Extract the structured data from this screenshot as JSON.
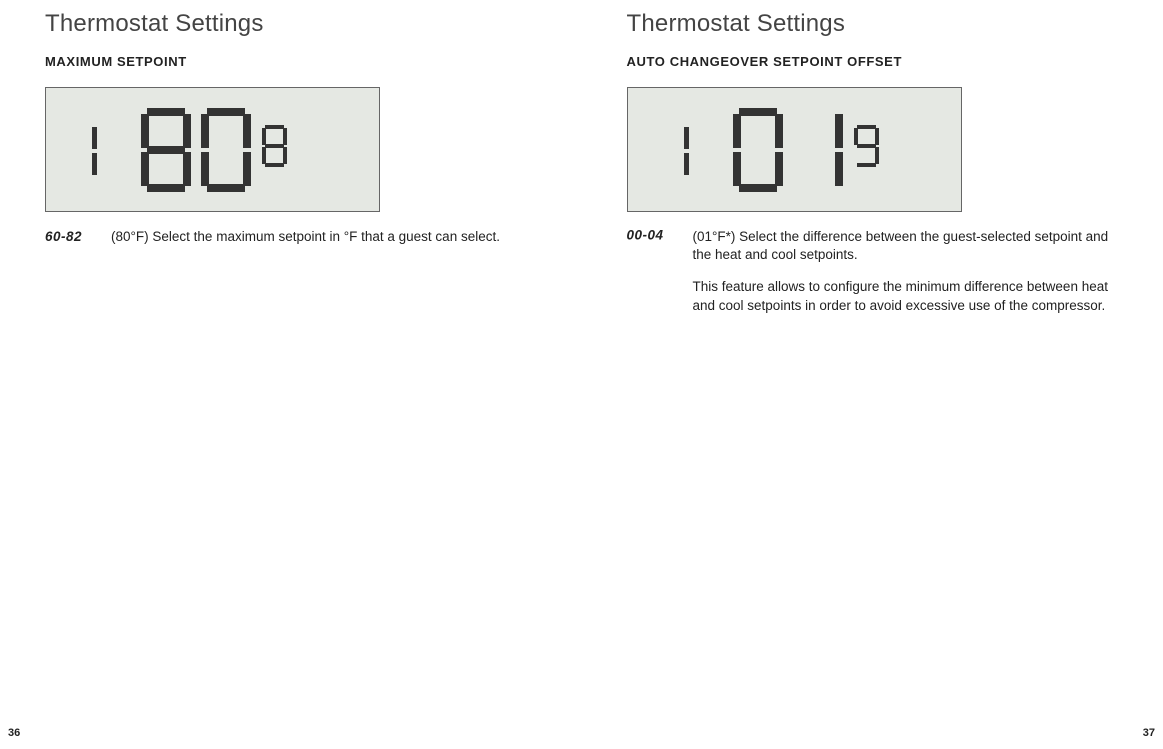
{
  "left": {
    "title": "Thermostat Settings",
    "subtitle": "MAXIMUM SETPOINT",
    "display_menu": "1",
    "display_value": "80",
    "display_setting": "8",
    "range": "60-82",
    "desc1": "(80°F) Select the maximum setpoint in °F that a guest can select.",
    "page_num": "36"
  },
  "right": {
    "title": "Thermostat Settings",
    "subtitle": "AUTO CHANGEOVER SETPOINT OFFSET",
    "display_menu": "1",
    "display_value": "01",
    "display_setting": "9",
    "range": "00-04",
    "desc1": "(01°F*) Select the difference between the guest-selected setpoint and the heat and cool setpoints.",
    "desc2": "This feature allows to configure the minimum difference between heat and cool setpoints in order to avoid excessive use of the compressor.",
    "page_num": "37"
  }
}
